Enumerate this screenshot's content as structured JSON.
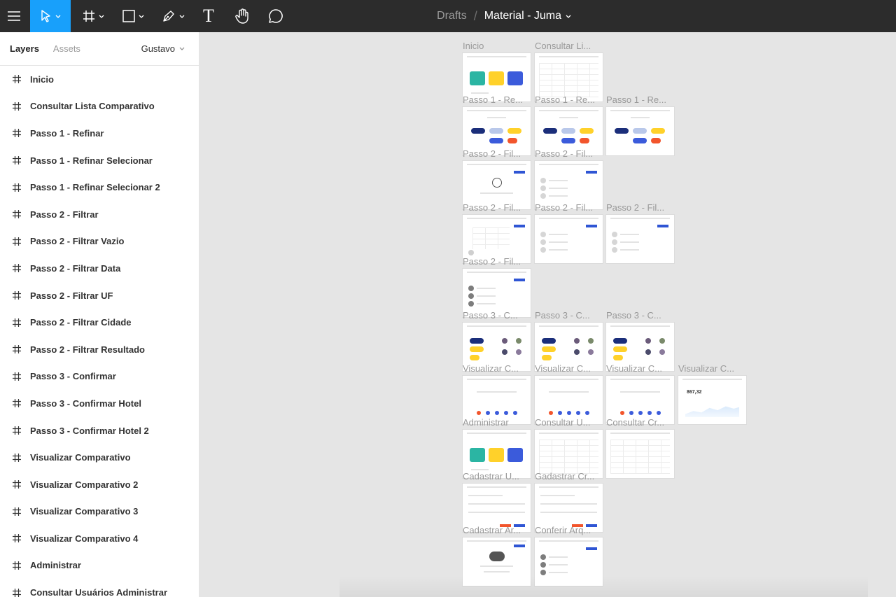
{
  "toolbar": {
    "icons": [
      "menu-icon",
      "move-tool-icon",
      "frame-tool-icon",
      "shape-tool-icon",
      "pen-tool-icon",
      "text-tool-icon",
      "hand-tool-icon",
      "comment-tool-icon"
    ],
    "text_tool_glyph": "T",
    "accent": "#18a0fb"
  },
  "breadcrumb": {
    "drafts": "Drafts",
    "separator": "/",
    "file_name": "Material - Juma"
  },
  "panel": {
    "tab_layers": "Layers",
    "tab_assets": "Assets",
    "page": "Gustavo",
    "layers": [
      "Inicio",
      "Consultar Lista Comparativo",
      "Passo 1 - Refinar",
      "Passo 1 - Refinar Selecionar",
      "Passo 1 - Refinar Selecionar 2",
      "Passo 2 - Filtrar",
      "Passo 2 - Filtrar Vazio",
      "Passo 2 - Filtrar Data",
      "Passo 2 - Filtrar UF",
      "Passo 2 - Filtrar Cidade",
      "Passo 2 - Filtrar Resultado",
      "Passo 3 - Confirmar",
      "Passo 3 - Confirmar Hotel",
      "Passo 3 - Confirmar Hotel 2",
      "Visualizar Comparativo",
      "Visualizar Comparativo 2",
      "Visualizar Comparativo 3",
      "Visualizar Comparativo 4",
      "Administrar",
      "Consultar Usuários Administrar"
    ]
  },
  "canvas": {
    "frame_labels": [
      "Inicio",
      "Consultar Li...",
      "Passo 1 - Re...",
      "Passo 1 - Re...",
      "Passo 1 - Re...",
      "Passo 2 - Fil...",
      "Passo 2 - Fil...",
      "Passo 2 - Fil...",
      "Passo 2 - Fil...",
      "Passo 2 - Fil...",
      "Passo 2 - Fil...",
      "Passo 3 - C...",
      "Passo 3 - C...",
      "Passo 3 - C...",
      "Visualizar C...",
      "Visualizar C...",
      "Visualizar C...",
      "Visualizar C...",
      "Administrar",
      "Consultar U...",
      "Consultar Cr...",
      "Cadastrar U...",
      "Gadastrar Cr...",
      "Cadastrar Ar...",
      "Conferir Arq..."
    ],
    "chart_value": "867,32"
  }
}
